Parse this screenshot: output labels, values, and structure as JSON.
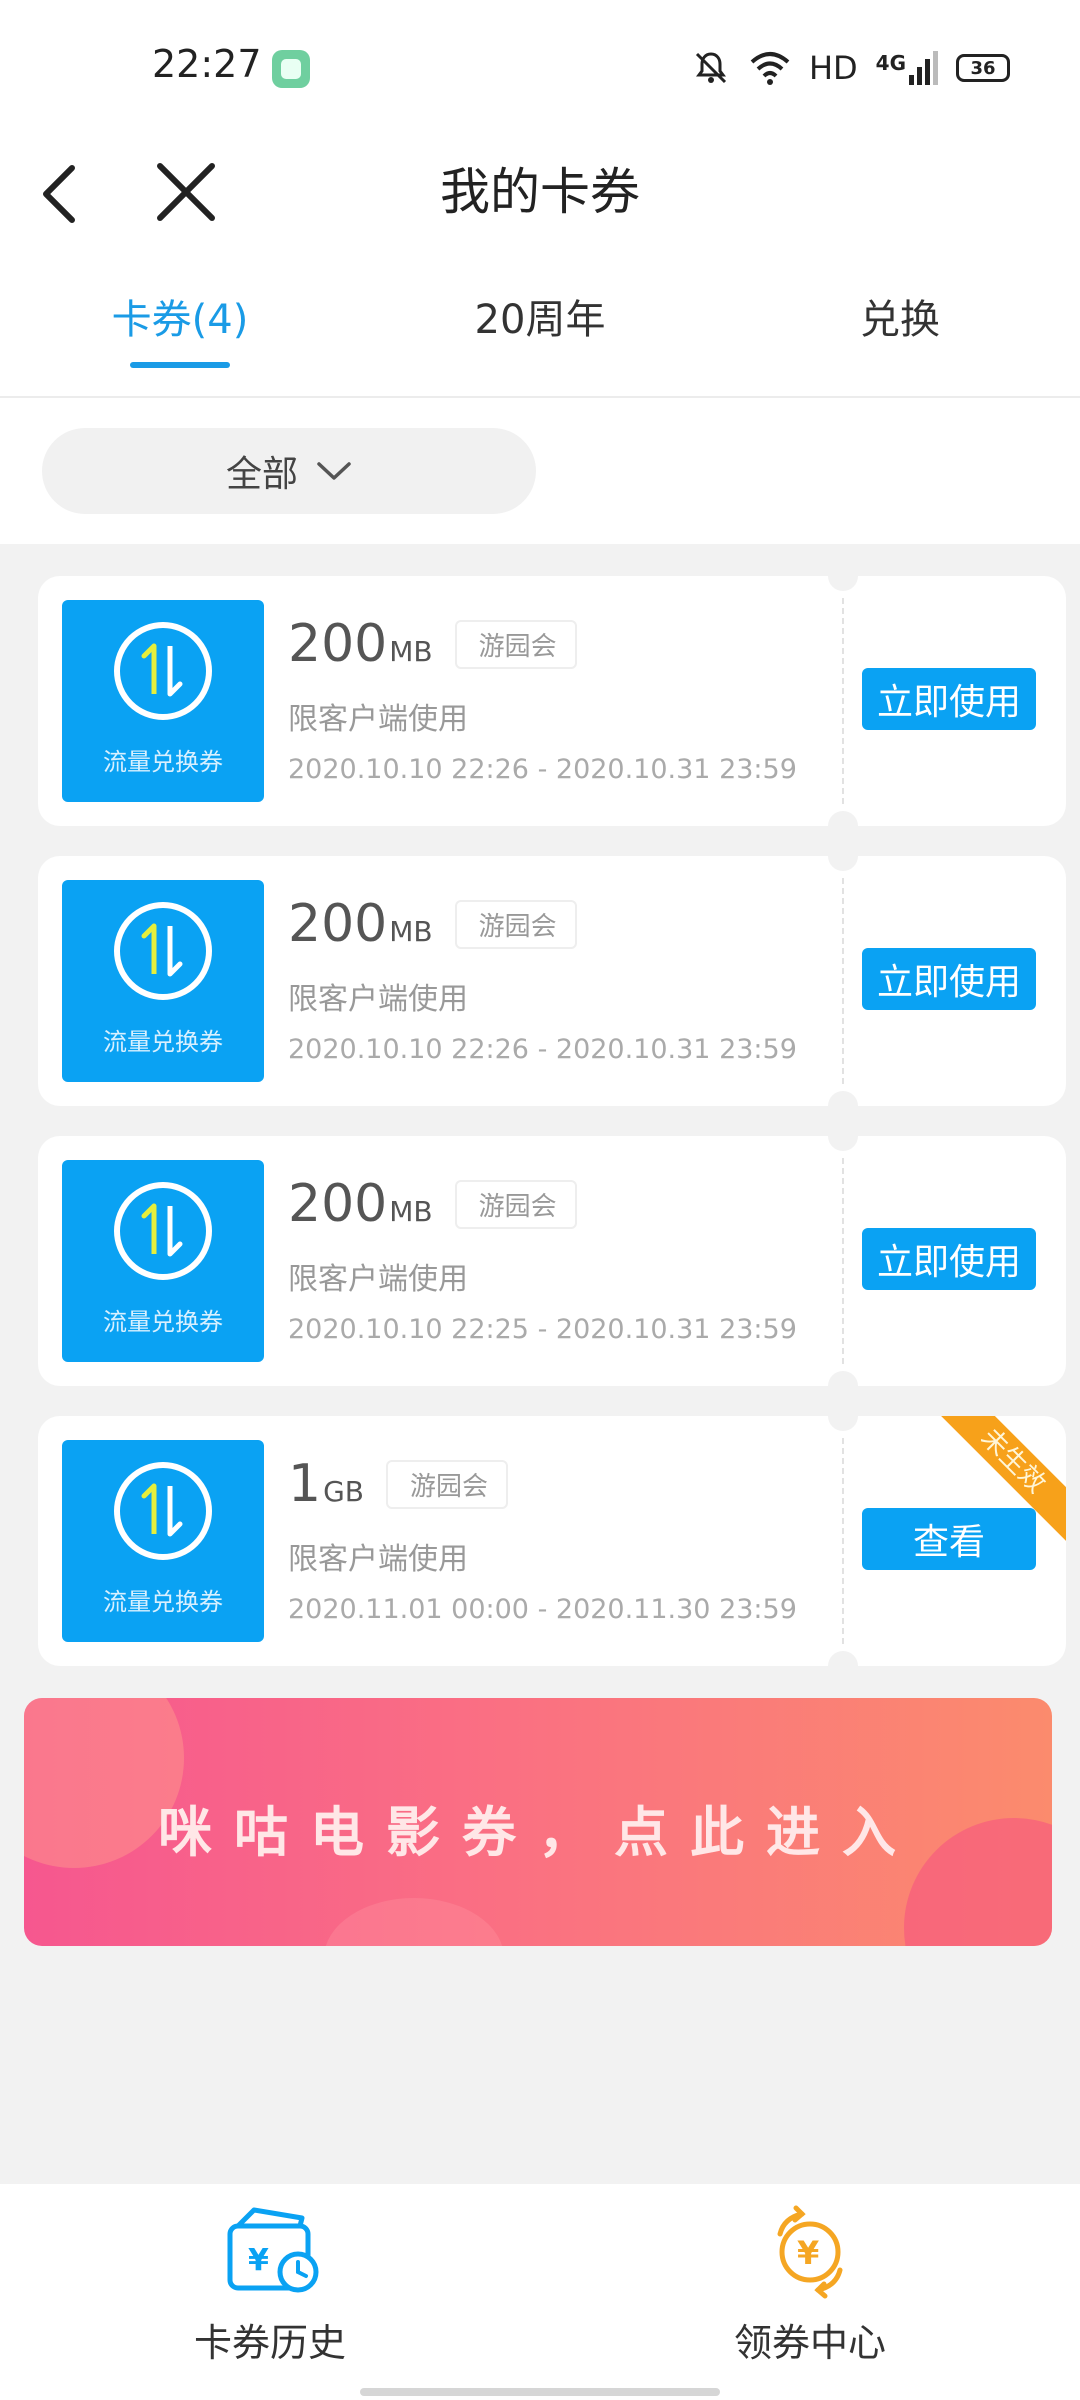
{
  "status_bar": {
    "time": "22:27",
    "network": "HD",
    "signal_type": "4G",
    "battery": "36"
  },
  "nav": {
    "title": "我的卡券"
  },
  "tabs": [
    {
      "label": "卡券(4)",
      "active": true
    },
    {
      "label": "20周年",
      "active": false
    },
    {
      "label": "兑换",
      "active": false
    }
  ],
  "filter": {
    "label": "全部"
  },
  "coupons": [
    {
      "thumb_label": "流量兑换券",
      "amount": "200",
      "unit": "MB",
      "tag": "游园会",
      "desc": "限客户端使用",
      "dates": "2020.10.10 22:26 - 2020.10.31 23:59",
      "button": "立即使用"
    },
    {
      "thumb_label": "流量兑换券",
      "amount": "200",
      "unit": "MB",
      "tag": "游园会",
      "desc": "限客户端使用",
      "dates": "2020.10.10 22:26 - 2020.10.31 23:59",
      "button": "立即使用"
    },
    {
      "thumb_label": "流量兑换券",
      "amount": "200",
      "unit": "MB",
      "tag": "游园会",
      "desc": "限客户端使用",
      "dates": "2020.10.10 22:25 - 2020.10.31 23:59",
      "button": "立即使用"
    },
    {
      "thumb_label": "流量兑换券",
      "amount": "1",
      "unit": "GB",
      "tag": "游园会",
      "desc": "限客户端使用",
      "dates": "2020.11.01 00:00 - 2020.11.30 23:59",
      "button": "查看",
      "ribbon": "未生效"
    }
  ],
  "banner": {
    "text": "咪咕电影券，点此进入"
  },
  "bottom_nav": [
    {
      "label": "卡券历史",
      "icon": "coupon-history-icon"
    },
    {
      "label": "领券中心",
      "icon": "coupon-center-icon"
    }
  ],
  "colors": {
    "accent": "#1a9be6",
    "coupon_blue": "#0aa2f3",
    "ribbon_orange": "#f7a11a",
    "banner_pink": "#f6578f",
    "banner_orange": "#fb8b6d"
  }
}
